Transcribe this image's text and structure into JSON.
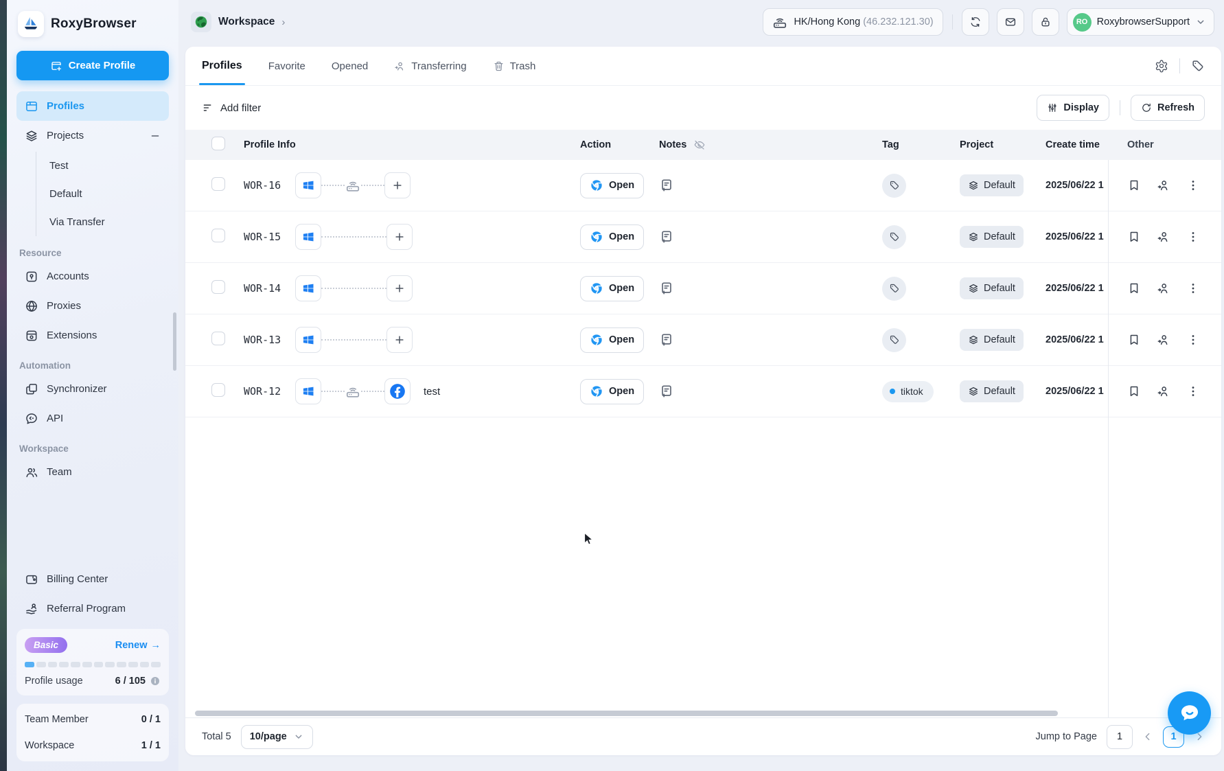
{
  "app": {
    "name": "RoxyBrowser"
  },
  "header": {
    "breadcrumb": {
      "label": "Workspace",
      "chevron": "›"
    },
    "proxy_chip": {
      "location": "HK/Hong Kong",
      "ip": "(46.232.121.30)"
    },
    "account": {
      "initials": "RO",
      "name": "RoxybrowserSupport"
    }
  },
  "sidebar": {
    "create_profile_label": "Create Profile",
    "profiles_label": "Profiles",
    "projects": {
      "label": "Projects",
      "children": [
        {
          "label": "Test"
        },
        {
          "label": "Default"
        },
        {
          "label": "Via Transfer"
        }
      ]
    },
    "sections": [
      {
        "title": "Resource",
        "items": [
          {
            "label": "Accounts"
          },
          {
            "label": "Proxies"
          },
          {
            "label": "Extensions"
          }
        ]
      },
      {
        "title": "Automation",
        "items": [
          {
            "label": "Synchronizer"
          },
          {
            "label": "API"
          }
        ]
      },
      {
        "title": "Workspace",
        "items": [
          {
            "label": "Team"
          }
        ]
      }
    ],
    "links": [
      {
        "label": "Billing Center"
      },
      {
        "label": "Referral Program"
      }
    ],
    "plan": {
      "badge": "Basic",
      "renew_label": "Renew",
      "renew_arrow": "→",
      "usage_label": "Profile usage",
      "usage_value": "6 / 105",
      "progress_segments": 12,
      "progress_filled": 1
    },
    "quota": [
      {
        "label": "Team Member",
        "value": "0 / 1"
      },
      {
        "label": "Workspace",
        "value": "1 / 1"
      }
    ]
  },
  "tabs": [
    {
      "label": "Profiles",
      "active": true
    },
    {
      "label": "Favorite"
    },
    {
      "label": "Opened"
    },
    {
      "label": "Transferring",
      "icon": "person-arrow"
    },
    {
      "label": "Trash",
      "icon": "trash"
    }
  ],
  "toolbar": {
    "add_filter": "Add filter",
    "display": "Display",
    "refresh": "Refresh"
  },
  "table": {
    "columns": {
      "profile": "Profile Info",
      "action": "Action",
      "notes": "Notes",
      "tag": "Tag",
      "project": "Project",
      "create": "Create time",
      "other": "Other"
    },
    "open_label": "Open",
    "rows": [
      {
        "id": "WOR-16",
        "os": "windows",
        "has_proxy": true,
        "platform": null,
        "name": "",
        "tag": null,
        "project": "Default",
        "create_time": "2025/06/22 1"
      },
      {
        "id": "WOR-15",
        "os": "windows",
        "has_proxy": false,
        "platform": null,
        "name": "",
        "tag": null,
        "project": "Default",
        "create_time": "2025/06/22 1"
      },
      {
        "id": "WOR-14",
        "os": "windows",
        "has_proxy": false,
        "platform": null,
        "name": "",
        "tag": null,
        "project": "Default",
        "create_time": "2025/06/22 1"
      },
      {
        "id": "WOR-13",
        "os": "windows",
        "has_proxy": false,
        "platform": null,
        "name": "",
        "tag": null,
        "project": "Default",
        "create_time": "2025/06/22 1"
      },
      {
        "id": "WOR-12",
        "os": "windows",
        "has_proxy": true,
        "platform": "facebook",
        "name": "test",
        "tag": "tiktok",
        "project": "Default",
        "create_time": "2025/06/22 1"
      }
    ]
  },
  "footer": {
    "total": "Total 5",
    "page_size": "10/page",
    "jump_label": "Jump to Page",
    "jump_value": "1",
    "page": "1"
  },
  "icons": {
    "os_icon": "windows-logo",
    "browser_icon": "chrome",
    "platform_icon_row5": "facebook",
    "notes_header_icon": "eye-off",
    "floating_button": "chat-bubble"
  },
  "colors": {
    "accent": "#1a97f0",
    "create_button": "#1598f2",
    "avatar_green": "#56c989",
    "basic_gradient": [
      "#c9a0f2",
      "#9270ee"
    ],
    "facebook_blue": "#1877f2",
    "windows_blue": "#1e7ff2",
    "tag_dot": "#1a97f0"
  }
}
